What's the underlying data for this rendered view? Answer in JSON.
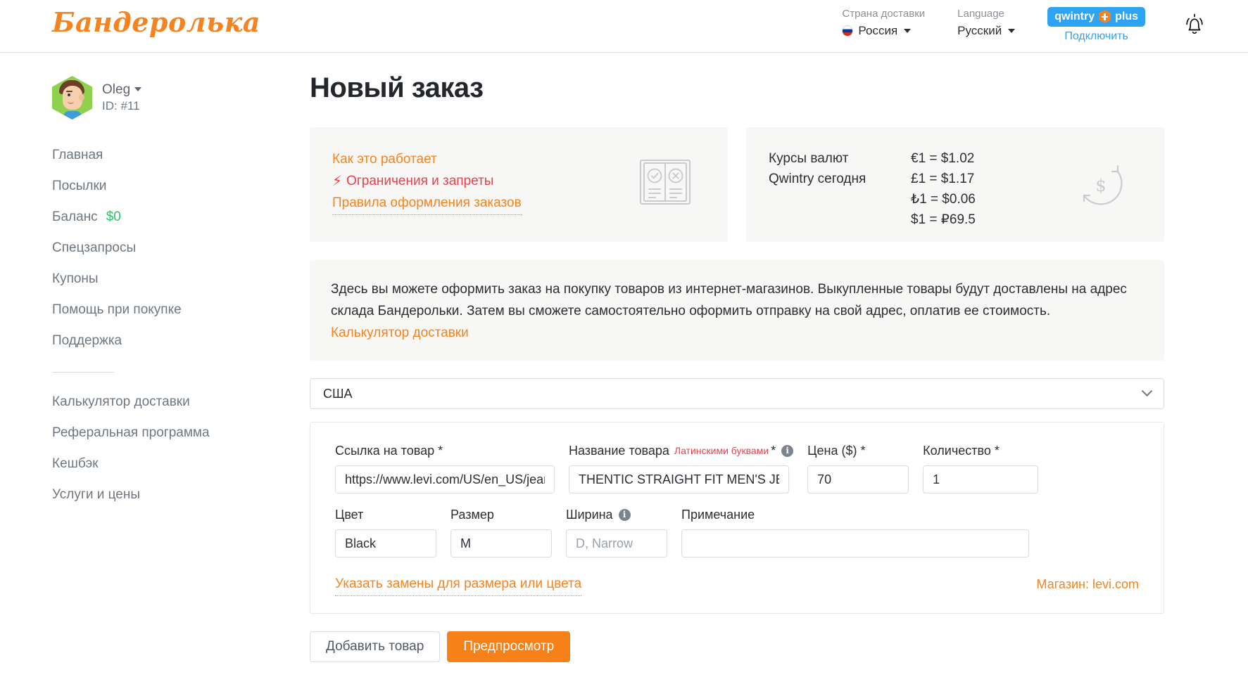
{
  "header": {
    "logo": "Бандеролька",
    "country": {
      "label": "Страна доставки",
      "value": "Россия",
      "flag": "ru-flag-icon"
    },
    "language": {
      "label": "Language",
      "value": "Русский"
    },
    "plus": {
      "brand": "qwintry",
      "suffix": "plus",
      "link": "Подключить"
    },
    "bell": "notifications-bell-icon"
  },
  "sidebar": {
    "user": {
      "name": "Oleg",
      "id": "ID: #11"
    },
    "items": [
      {
        "label": "Главная"
      },
      {
        "label": "Посылки"
      },
      {
        "label": "Баланс",
        "value": "$0"
      },
      {
        "label": "Спецзапросы"
      },
      {
        "label": "Купоны"
      },
      {
        "label": "Помощь при покупке"
      },
      {
        "label": "Поддержка"
      }
    ],
    "items2": [
      {
        "label": "Калькулятор доставки"
      },
      {
        "label": "Реферальная программа"
      },
      {
        "label": "Кешбэк"
      },
      {
        "label": "Услуги и цены"
      }
    ]
  },
  "main": {
    "title": "Новый заказ",
    "how_card": {
      "link1": "Как это работает",
      "link2": "Ограничения и запреты",
      "link3": "Правила оформления заказов"
    },
    "rates_card": {
      "title": "Курсы валют Qwintry сегодня",
      "rates": [
        "€1 = $1.02",
        "£1 = $1.17",
        "₺1 = $0.06",
        "$1 = ₽69.5"
      ]
    },
    "description": {
      "text": "Здесь вы можете оформить заказ на покупку товаров из интернет-магазинов. Выкупленные товары будут доставлены на адрес склада Бандерольки. Затем вы сможете самостоятельно оформить отправку на свой адрес, оплатив ее стоимость.",
      "link": "Калькулятор доставки"
    },
    "country_select": {
      "value": "США"
    },
    "item_form": {
      "url": {
        "label": "Ссылка на товар *",
        "value": "https://www.levi.com/US/en_US/jeans",
        "placeholder": ""
      },
      "name": {
        "label": "Название товара",
        "note": "Латинскими буквами",
        "star": "*",
        "value": "THENTIC STRAIGHT FIT MEN'S JEANS",
        "placeholder": ""
      },
      "price": {
        "label": "Цена ($) *",
        "value": "70",
        "placeholder": ""
      },
      "qty": {
        "label": "Количество *",
        "value": "1",
        "placeholder": ""
      },
      "color": {
        "label": "Цвет",
        "value": "Black",
        "placeholder": ""
      },
      "size": {
        "label": "Размер",
        "value": "M",
        "placeholder": ""
      },
      "width": {
        "label": "Ширина",
        "value": "",
        "placeholder": "D, Narrow"
      },
      "note_field": {
        "label": "Примечание",
        "value": "",
        "placeholder": ""
      },
      "substitutes_link": "Указать замены для размера или цвета",
      "shop": "Магазин: levi.com"
    },
    "buttons": {
      "add": "Добавить товар",
      "preview": "Предпросмотр"
    }
  },
  "colors": {
    "orange": "#f5831f",
    "red": "#ef3e4a",
    "blue": "#2ea3f2",
    "green": "#2ec36a",
    "card_bg": "#f7f7f5"
  }
}
